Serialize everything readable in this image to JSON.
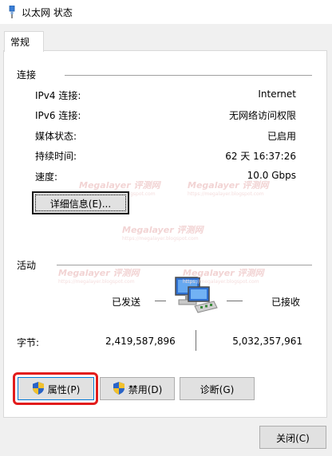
{
  "window": {
    "title": "以太网 状态"
  },
  "tab": {
    "label": "常规"
  },
  "connection": {
    "heading": "连接",
    "rows": [
      {
        "label": "IPv4 连接:",
        "value": "Internet"
      },
      {
        "label": "IPv6 连接:",
        "value": "无网络访问权限"
      },
      {
        "label": "媒体状态:",
        "value": "已启用"
      },
      {
        "label": "持续时间:",
        "value": "62 天 16:37:26"
      },
      {
        "label": "速度:",
        "value": "10.0 Gbps"
      }
    ],
    "details_button": "详细信息(E)..."
  },
  "activity": {
    "heading": "活动",
    "sent_label": "已发送",
    "received_label": "已接收",
    "bytes_label": "字节:",
    "bytes_sent": "2,419,587,896",
    "bytes_received": "5,032,357,961"
  },
  "buttons": {
    "properties": "属性(P)",
    "disable": "禁用(D)",
    "diagnose": "诊断(G)",
    "close": "关闭(C)"
  },
  "watermark": {
    "text": "Megalayer 评测网",
    "sub": "https://megalayer.blogspot.com"
  },
  "colors": {
    "highlight": "#e21c1c",
    "panel": "#ffffff",
    "window_bg": "#f0f0f0"
  }
}
